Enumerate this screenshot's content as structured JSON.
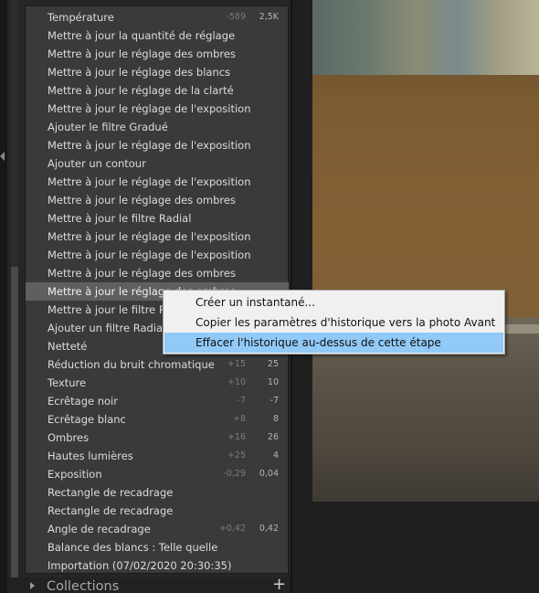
{
  "history": {
    "items": [
      {
        "label": "Température",
        "before": "-589",
        "after": "2,5K"
      },
      {
        "label": "Mettre à jour la quantité de réglage",
        "before": "",
        "after": ""
      },
      {
        "label": "Mettre à jour le réglage des ombres",
        "before": "",
        "after": ""
      },
      {
        "label": "Mettre à jour le réglage des blancs",
        "before": "",
        "after": ""
      },
      {
        "label": "Mettre à jour le réglage de la clarté",
        "before": "",
        "after": ""
      },
      {
        "label": "Mettre à jour le réglage de l'exposition",
        "before": "",
        "after": ""
      },
      {
        "label": "Ajouter le filtre Gradué",
        "before": "",
        "after": ""
      },
      {
        "label": "Mettre à jour le réglage de l'exposition",
        "before": "",
        "after": ""
      },
      {
        "label": "Ajouter un contour",
        "before": "",
        "after": ""
      },
      {
        "label": "Mettre à jour le réglage de l'exposition",
        "before": "",
        "after": ""
      },
      {
        "label": "Mettre à jour le réglage des ombres",
        "before": "",
        "after": ""
      },
      {
        "label": "Mettre à jour le filtre Radial",
        "before": "",
        "after": ""
      },
      {
        "label": "Mettre à jour le réglage de l'exposition",
        "before": "",
        "after": ""
      },
      {
        "label": "Mettre à jour le réglage de l'exposition",
        "before": "",
        "after": ""
      },
      {
        "label": "Mettre à jour le réglage des ombres",
        "before": "",
        "after": ""
      },
      {
        "label": "Mettre à jour le réglage des ombres",
        "before": "",
        "after": ""
      },
      {
        "label": "Mettre à jour le filtre Radial",
        "before": "",
        "after": ""
      },
      {
        "label": "Ajouter un filtre Radial",
        "before": "",
        "after": ""
      },
      {
        "label": "Netteté",
        "before": "",
        "after": ""
      },
      {
        "label": "Réduction du bruit chromatique",
        "before": "+15",
        "after": "25"
      },
      {
        "label": "Texture",
        "before": "+10",
        "after": "10"
      },
      {
        "label": "Ecrêtage noir",
        "before": "-7",
        "after": "-7"
      },
      {
        "label": "Ecrêtage blanc",
        "before": "+8",
        "after": "8"
      },
      {
        "label": "Ombres",
        "before": "+16",
        "after": "26"
      },
      {
        "label": "Hautes lumières",
        "before": "+25",
        "after": "4"
      },
      {
        "label": "Exposition",
        "before": "-0,29",
        "after": "0,04"
      },
      {
        "label": "Rectangle de recadrage",
        "before": "",
        "after": ""
      },
      {
        "label": "Rectangle de recadrage",
        "before": "",
        "after": ""
      },
      {
        "label": "Angle de recadrage",
        "before": "+0,42",
        "after": "0,42"
      },
      {
        "label": "Balance des blancs : Telle quelle",
        "before": "",
        "after": ""
      },
      {
        "label": "Importation (07/02/2020 20:30:35)",
        "before": "",
        "after": ""
      }
    ],
    "selected_index": 15
  },
  "collections": {
    "title": "Collections",
    "add_icon": "plus-icon",
    "expand_icon": "triangle-right-icon"
  },
  "context_menu": {
    "items": [
      {
        "label": "Créer un instantané..."
      },
      {
        "label": "Copier les paramètres d'historique vers la photo Avant"
      },
      {
        "label": "Effacer l'historique au-dessus de cette étape"
      }
    ],
    "highlighted_index": 2
  },
  "colors": {
    "panel_bg": "#3a3a3a",
    "selected_row": "#5f5f5f",
    "menu_bg": "#f0f0f0",
    "menu_highlight": "#91c9f7"
  }
}
